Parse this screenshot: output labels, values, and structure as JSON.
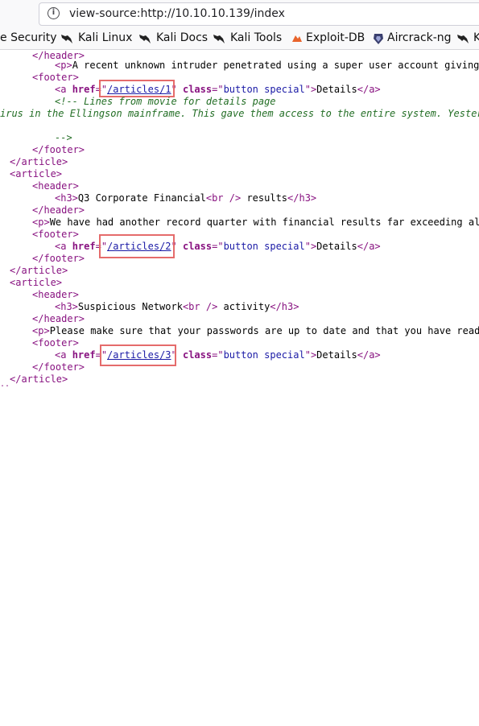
{
  "browser": {
    "url": "view-source:http://10.10.10.139/index",
    "bookmarks": [
      {
        "label": "e Security"
      },
      {
        "label": "Kali Linux"
      },
      {
        "label": "Kali Docs"
      },
      {
        "label": "Kali Tools"
      },
      {
        "label": "Exploit-DB"
      },
      {
        "label": "Aircrack-ng"
      },
      {
        "label": "K"
      }
    ]
  },
  "source": {
    "l0": "</header>",
    "l1": {
      "open": "<p>",
      "text": "A recent unknown intruder penetrated using a super user account giving hi"
    },
    "l2": "<footer>",
    "l3": {
      "href": "/articles/1",
      "cls": "button special",
      "text": "Details"
    },
    "l4": "<!-- Lines from movie for details page",
    "l5": "irus in the Ellingson mainframe. This gave them access to the entire system. Yesterday",
    "l6": "-->",
    "l7": "</footer>",
    "l8": "</article>",
    "l9": "<article>",
    "l10": "<header>",
    "l11": {
      "pre": "Q3 Corporate Financial",
      "post": " results"
    },
    "l12": "</header>",
    "l13": "We have had another record quarter with financial results far exceeding all e",
    "l14": "<footer>",
    "l15": {
      "href": "/articles/2",
      "cls": "button special",
      "text": "Details"
    },
    "l16": "</footer>",
    "l17": "</article>",
    "l18": "<article>",
    "l19": "<header>",
    "l20": {
      "pre": "Suspicious Network",
      "post": " activity"
    },
    "l21": "</header>",
    "l22": "Please make sure that your passwords are up to date and that you have read ou",
    "l23": "<footer>",
    "l24": {
      "href": "/articles/3",
      "cls": "button special",
      "text": "Details"
    },
    "l25": "</footer>",
    "l26": "</article>",
    "l27": ".."
  }
}
